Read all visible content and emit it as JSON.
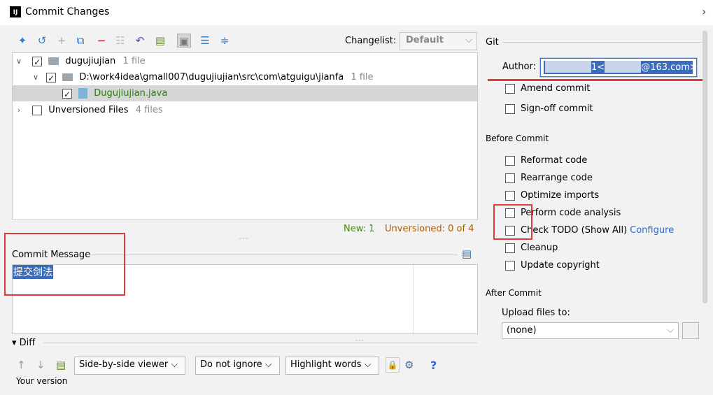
{
  "window": {
    "title": "Commit Changes",
    "app_icon": "IJ"
  },
  "toolbar": {
    "icons": [
      "refresh-icon",
      "undo-icon",
      "add-icon",
      "move-icon",
      "remove-icon",
      "group-icon",
      "rollback-icon",
      "diff-icon",
      "preview-icon",
      "expand-all-icon",
      "collapse-all-icon"
    ],
    "changelist_label": "Changelist:",
    "changelist_value": "Default"
  },
  "tree": {
    "root_label": "dugujiujian",
    "root_count": "1 file",
    "dir_label": "D:\\work4idea\\gmall007\\dugujiujian\\src\\com\\atguigu\\jianfa",
    "dir_count": "1 file",
    "file_label": "Dugujiujian.java",
    "unversioned_label": "Unversioned Files",
    "unversioned_count": "4 files"
  },
  "status": {
    "new": "New: 1",
    "unversioned": "Unversioned: 0 of 4"
  },
  "commit_message": {
    "label": "Commit Message",
    "value": "提交剑法"
  },
  "diff": {
    "label": "Diff",
    "viewer": "Side-by-side viewer",
    "ignore": "Do not ignore",
    "highlight": "Highlight words",
    "your_version": "Your version"
  },
  "git": {
    "section": "Git",
    "author_label": "Author:",
    "author_value_start": "1<",
    "author_value_end": "@163.com>",
    "amend": "Amend commit",
    "signoff": "Sign-off commit"
  },
  "before_commit": {
    "section": "Before Commit",
    "options": [
      "Reformat code",
      "Rearrange code",
      "Optimize imports",
      "Perform code analysis",
      "Check TODO (Show All)",
      "Cleanup",
      "Update copyright"
    ],
    "configure": "Configure"
  },
  "after_commit": {
    "section": "After Commit",
    "upload_label": "Upload files to:",
    "upload_value": "(none)"
  },
  "colors": {
    "accent": "#3b6dbb",
    "highlight": "#e03a3a"
  }
}
